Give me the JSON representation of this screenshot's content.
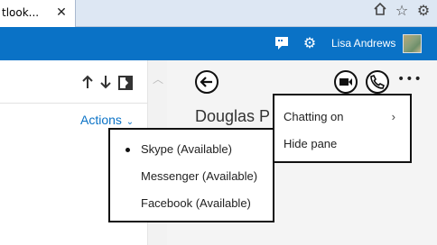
{
  "browser": {
    "tab_title": "tlook...",
    "tab_close_icon": "close-icon",
    "icons": [
      "home-icon",
      "star-icon",
      "gear-icon"
    ]
  },
  "header": {
    "icons": [
      "chat-icon",
      "gear-icon"
    ],
    "user_name": "Lisa Andrews",
    "accent_color": "#0a72c6"
  },
  "left_pane": {
    "icons": [
      "arrow-up-icon",
      "arrow-down-icon",
      "pop-out-icon"
    ],
    "actions_label": "Actions"
  },
  "conversation": {
    "contact_name": "Douglas P",
    "icons": [
      "back-icon",
      "video-icon",
      "phone-icon",
      "more-icon"
    ]
  },
  "chat_menu": {
    "items": [
      {
        "label": "Chatting on"
      },
      {
        "label": "Hide pane"
      }
    ]
  },
  "service_menu": {
    "selected_index": 0,
    "items": [
      {
        "label": "Skype (Available)"
      },
      {
        "label": "Messenger (Available)"
      },
      {
        "label": "Facebook (Available)"
      }
    ]
  }
}
